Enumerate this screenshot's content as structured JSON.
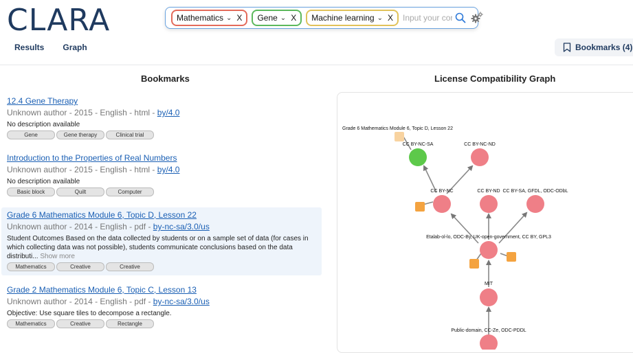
{
  "app": {
    "logo": "CLARA"
  },
  "search": {
    "chips": [
      {
        "label": "Mathematics",
        "color": "#e36a5a"
      },
      {
        "label": "Gene",
        "color": "#5cb85c"
      },
      {
        "label": "Machine learning",
        "color": "#e0c25a"
      }
    ],
    "chip_close": "X",
    "placeholder": "Input your cor"
  },
  "nav": {
    "tabs": [
      "Results",
      "Graph"
    ]
  },
  "bookmarks_button": "Bookmarks (4)",
  "left_title": "Bookmarks",
  "right_title": "License Compatibility Graph",
  "bookmarks": [
    {
      "title": "12.4 Gene Therapy",
      "meta": "Unknown author - 2015 - English - html - ",
      "license": "by/4.0",
      "description": "No description available",
      "show_more": "",
      "tags": [
        "Gene",
        "Gene therapy",
        "Clinical trial"
      ],
      "highlight": false
    },
    {
      "title": "Introduction to the Properties of Real Numbers",
      "meta": "Unknown author - 2015 - English - html - ",
      "license": "by/4.0",
      "description": "No description available",
      "show_more": "",
      "tags": [
        "Basic block",
        "Quilt",
        "Computer"
      ],
      "highlight": false
    },
    {
      "title": "Grade 6 Mathematics Module 6, Topic D, Lesson 22",
      "meta": "Unknown author - 2014 - English - pdf - ",
      "license": "by-nc-sa/3.0/us",
      "description": "Student Outcomes Based on the data collected by students or on a sample set of data (for cases in which collecting data was not possible), students communicate conclusions based on the data distributi...",
      "show_more": "Show more",
      "tags": [
        "Mathematics",
        "Creative",
        "Creative"
      ],
      "highlight": true
    },
    {
      "title": "Grade 2 Mathematics Module 6, Topic C, Lesson 13",
      "meta": "Unknown author - 2014 - English - pdf - ",
      "license": "by-nc-sa/3.0/us",
      "description": "Objective: Use square tiles to decompose a rectangle.",
      "show_more": "",
      "tags": [
        "Mathematics",
        "Creative",
        "Rectangle"
      ],
      "highlight": false
    }
  ],
  "graph": {
    "node_colors": {
      "default": "#ef7f87",
      "selected": "#5dc94a",
      "doc": "#f4a340",
      "doc_light": "#f8d3a0"
    },
    "labels": {
      "doc": "Grade 6 Mathematics Module 6, Topic D, Lesson 22",
      "cc_by_nc_sa": "CC BY-NC-SA",
      "cc_by_nc_nd": "CC BY-NC-ND",
      "cc_by_nc": "CC BY-NC",
      "cc_by_nd": "CC BY-ND",
      "cc_by_sa": "CC BY-SA, GFDL, ODC-ODbL",
      "cc_by": "Etalab-ol-lo, ODC-By, UK-open-government, CC BY, GPL3",
      "mit": "MIT",
      "public": "Public-domain, CC-Ze, ODC-PDDL"
    }
  }
}
